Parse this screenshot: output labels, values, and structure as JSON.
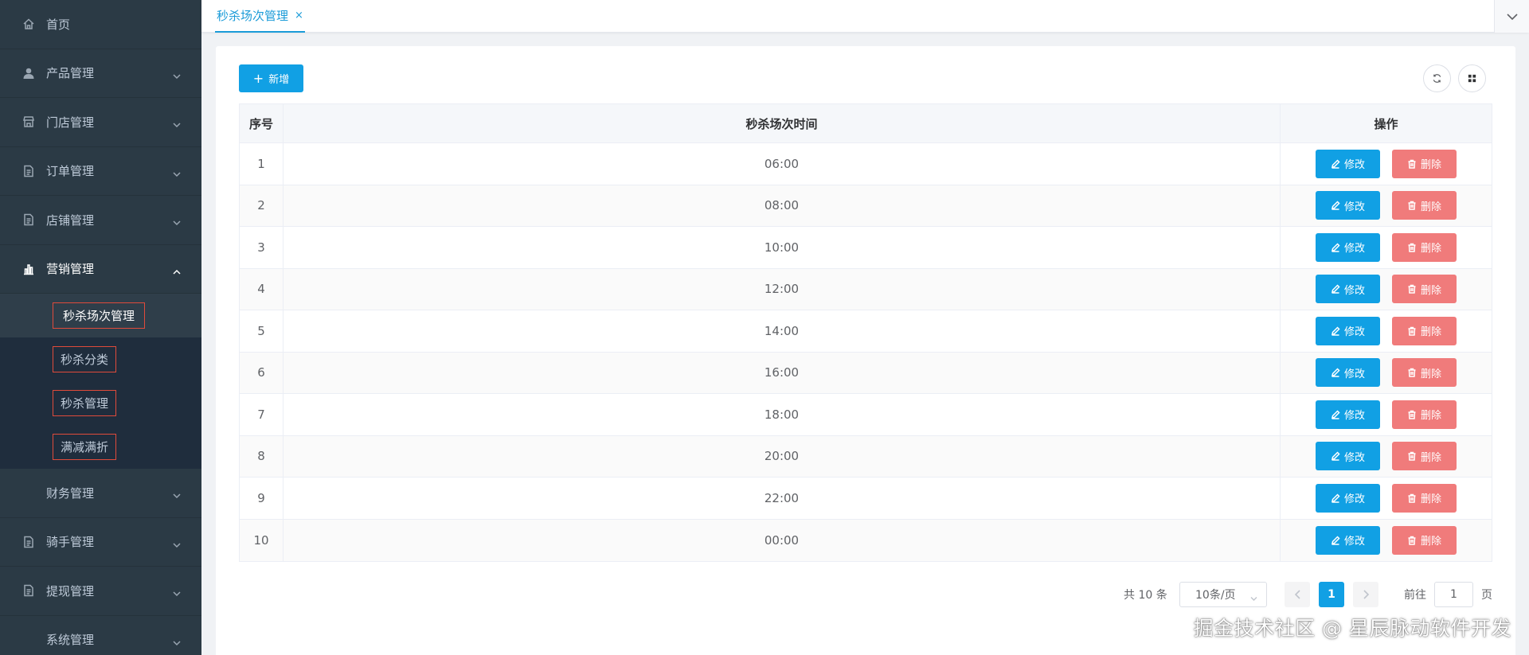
{
  "sidebar": {
    "items": [
      {
        "label": "首页",
        "icon": "home-icon",
        "chevron": false
      },
      {
        "label": "产品管理",
        "icon": "user-icon",
        "chevron": true
      },
      {
        "label": "门店管理",
        "icon": "store-icon",
        "chevron": true
      },
      {
        "label": "订单管理",
        "icon": "document-icon",
        "chevron": true
      },
      {
        "label": "店铺管理",
        "icon": "document-icon",
        "chevron": true
      },
      {
        "label": "营销管理",
        "icon": "bar-chart-icon",
        "chevron": true,
        "open": true
      }
    ],
    "submenu": [
      {
        "label": "秒杀场次管理",
        "active": true
      },
      {
        "label": "秒杀分类"
      },
      {
        "label": "秒杀管理"
      },
      {
        "label": "满减满折"
      }
    ],
    "items_after": [
      {
        "label": "财务管理",
        "icon": "",
        "chevron": true
      },
      {
        "label": "骑手管理",
        "icon": "document-icon",
        "chevron": true
      },
      {
        "label": "提现管理",
        "icon": "document-icon",
        "chevron": true
      },
      {
        "label": "系统管理",
        "icon": "",
        "chevron": true
      }
    ]
  },
  "tabs": {
    "active_label": "秒杀场次管理",
    "close": "×"
  },
  "toolbar": {
    "add_label": "新增"
  },
  "table": {
    "headers": [
      "序号",
      "秒杀场次时间",
      "操作"
    ],
    "edit_label": "修改",
    "delete_label": "删除",
    "rows": [
      {
        "index": "1",
        "time": "06:00"
      },
      {
        "index": "2",
        "time": "08:00"
      },
      {
        "index": "3",
        "time": "10:00"
      },
      {
        "index": "4",
        "time": "12:00"
      },
      {
        "index": "5",
        "time": "14:00"
      },
      {
        "index": "6",
        "time": "16:00"
      },
      {
        "index": "7",
        "time": "18:00"
      },
      {
        "index": "8",
        "time": "20:00"
      },
      {
        "index": "9",
        "time": "22:00"
      },
      {
        "index": "10",
        "time": "00:00"
      }
    ]
  },
  "pagination": {
    "total_text": "共 10 条",
    "page_size": "10条/页",
    "current_page": "1",
    "goto_prefix": "前往",
    "goto_value": "1",
    "goto_suffix": "页"
  },
  "watermark": "掘金技术社区 @ 星辰脉动软件开发",
  "colors": {
    "primary": "#11a0e4",
    "danger": "#f07b7b",
    "sidebar": "#2b3a45",
    "highlight_box": "#e04b3b"
  }
}
